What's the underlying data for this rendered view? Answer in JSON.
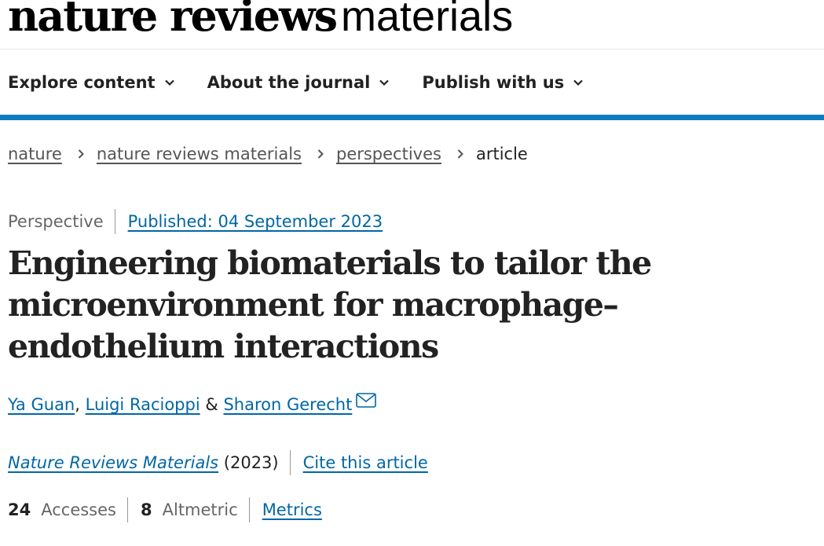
{
  "masthead": {
    "brand": "nature reviews",
    "sub": "materials"
  },
  "nav": {
    "items": [
      {
        "label": "Explore content"
      },
      {
        "label": "About the journal"
      },
      {
        "label": "Publish with us"
      }
    ]
  },
  "breadcrumb": {
    "items": [
      {
        "label": "nature"
      },
      {
        "label": "nature reviews materials"
      },
      {
        "label": "perspectives"
      }
    ],
    "current": "article"
  },
  "article": {
    "type": "Perspective",
    "published": "Published: 04 September 2023",
    "title": "Engineering biomaterials to tailor the microenvironment for macrophage–endothelium interactions",
    "authors": [
      "Ya Guan",
      "Luigi Racioppi",
      "Sharon Gerecht"
    ],
    "author_sep": ",",
    "author_and": "&",
    "journal": "Nature Reviews Materials",
    "year": "(2023)",
    "cite_label": "Cite this article",
    "metrics": {
      "accesses_value": "24",
      "accesses_label": "Accesses",
      "altmetric_value": "8",
      "altmetric_label": "Altmetric",
      "metrics_link": "Metrics"
    }
  },
  "colors": {
    "accent": "#0f7cbf",
    "link": "#0067a5"
  }
}
